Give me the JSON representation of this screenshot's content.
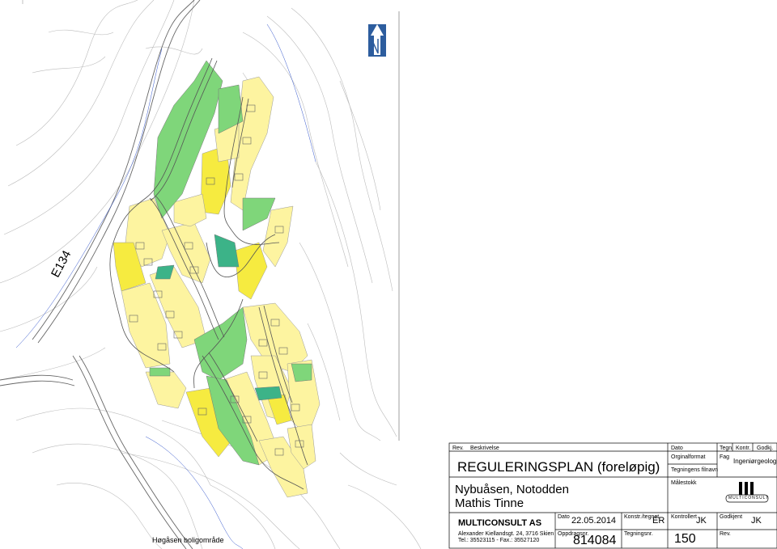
{
  "map": {
    "road_label": "E134",
    "area_name": "Høgåsen boligområde",
    "colors": {
      "residential": "#fdf4a0",
      "residential_dense": "#f6eb40",
      "green_area": "#7fd67a",
      "green_dark": "#3cb388",
      "contour": "#b5b5b5",
      "road": "#777777"
    },
    "north_arrow_icon": "north-arrow-icon"
  },
  "title_block": {
    "rev_label": "Rev.",
    "description_label": "Beskrivelse",
    "dato_header": "Dato",
    "tegn_label": "Tegn.",
    "kontr_label": "Kontr.",
    "godkj_label": "Godkj.",
    "plan_title": "REGULERINGSPLAN (foreløpig)",
    "original_format_label": "Orginalformat",
    "fag_label": "Fag",
    "fag_value": "Ingeniørgeologi",
    "filename_label": "Tegningens filnavn",
    "location": "Nybuåsen, Notodden",
    "client": "Mathis Tinne",
    "scale_label": "Målestokk",
    "company": "MULTICONSULT AS",
    "address": "Alexander Kiellandsgt. 24, 3716 Skien",
    "phone": "Tel.: 35523115 - Fax.: 35527120",
    "date_label": "Dato",
    "date_value": "22.05.2014",
    "konstr_label": "Konstr./tegnet",
    "konstr_value": "ER",
    "kontrollert_label": "Kontrollert",
    "kontrollert_value": "JK",
    "godkjent_label": "Godkjent",
    "godkjent_value": "JK",
    "oppdrag_label": "Oppdragsnr.",
    "oppdrag_value": "814084",
    "tegningsnr_label": "Tegningsnr.",
    "tegningsnr_value": "150",
    "rev2_label": "Rev.",
    "logo_text": "MULTICONSULT"
  }
}
